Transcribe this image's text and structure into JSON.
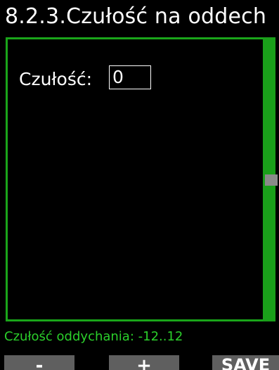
{
  "header": {
    "title": "8.2.3.Czułość na oddech"
  },
  "setting": {
    "label": "Czułość:",
    "value": "0"
  },
  "hint": {
    "text": "Czułość oddychania: -12..12"
  },
  "softkeys": {
    "minus_label": "-",
    "plus_label": "+",
    "save_label": "SAVE"
  },
  "colors": {
    "accent_green": "#1aa51a",
    "hint_green": "#2bcf2b",
    "softkey_gray": "#5f5f5f",
    "scroll_thumb_gray": "#8a8a8a"
  }
}
